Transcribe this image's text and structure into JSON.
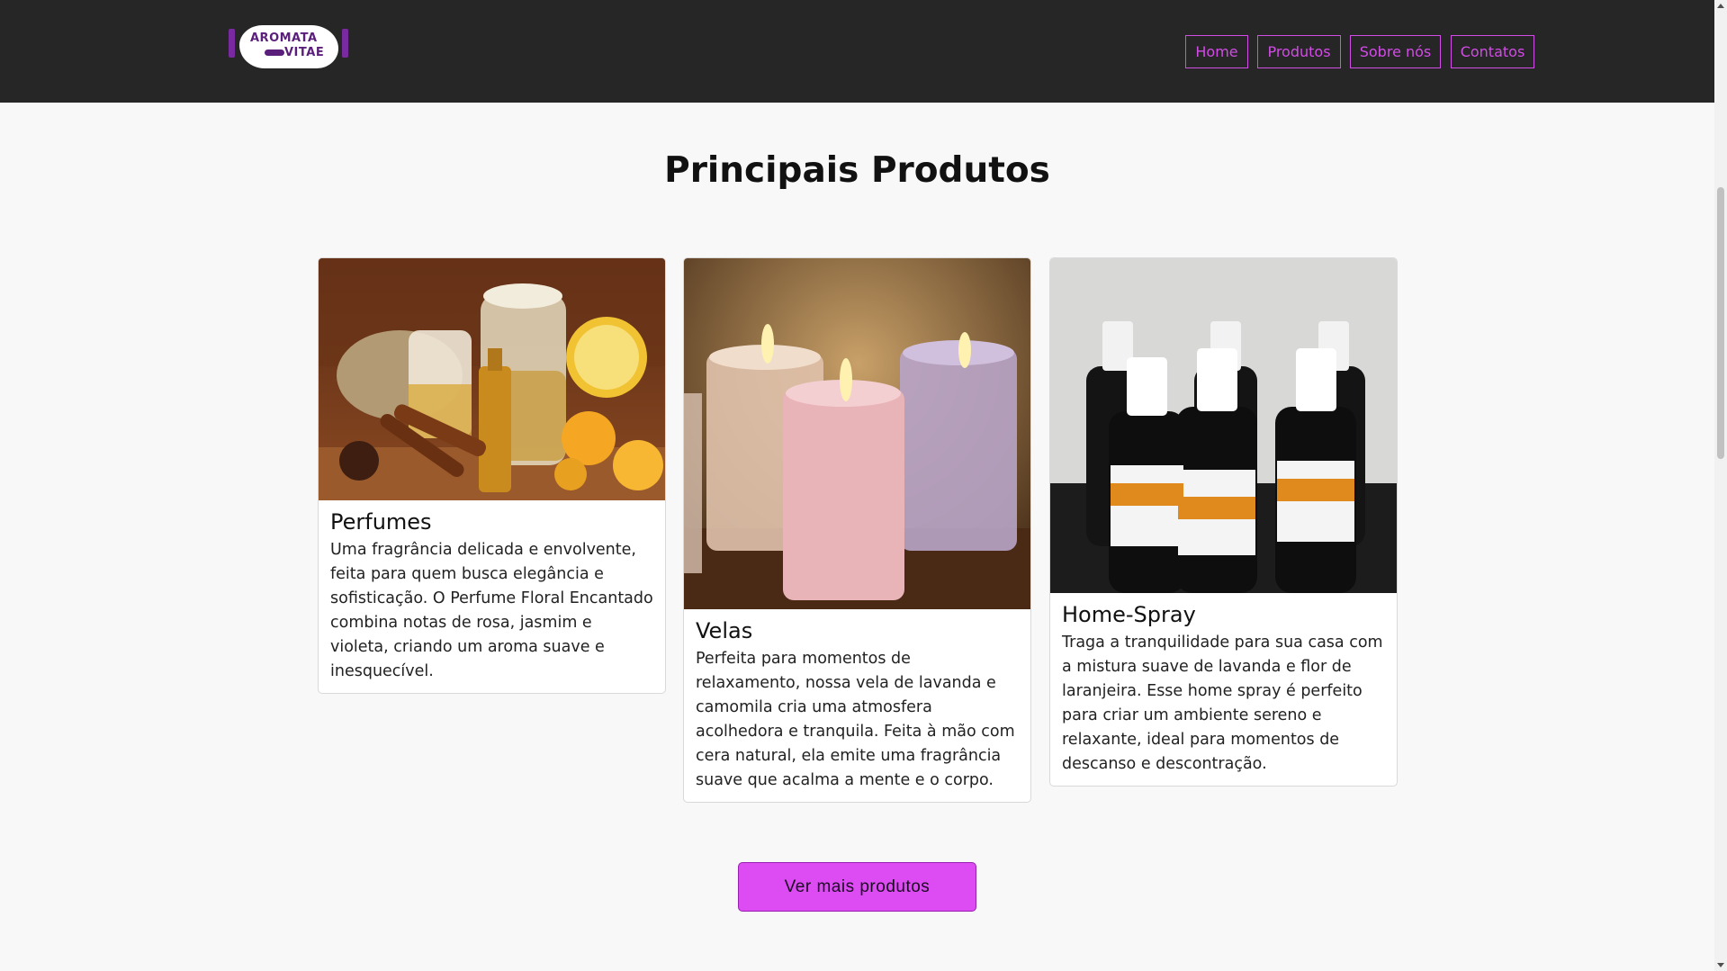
{
  "header": {
    "logo_line1": "AROMATA",
    "logo_line2": "VITAE",
    "nav": [
      {
        "label": "Home"
      },
      {
        "label": "Produtos"
      },
      {
        "label": "Sobre nós"
      },
      {
        "label": "Contatos"
      }
    ]
  },
  "main": {
    "title": "Principais Produtos",
    "cards": [
      {
        "title": "Perfumes",
        "text": "Uma fragrância delicada e envolvente, feita para quem busca elegância e sofisticação. O Perfume Floral Encantado combina notas de rosa, jasmim e violeta, criando um aroma suave e inesquecível."
      },
      {
        "title": "Velas",
        "text": "Perfeita para momentos de relaxamento, nossa vela de lavanda e camomila cria uma atmosfera acolhedora e tranquila. Feita à mão com cera natural, ela emite uma fragrância suave que acalma a mente e o corpo."
      },
      {
        "title": "Home-Spray",
        "text": "Traga a tranquilidade para sua casa com a mistura suave de lavanda e flor de laranjeira. Esse home spray é perfeito para criar um ambiente sereno e relaxante, ideal para momentos de descanso e descontração."
      }
    ],
    "cta_label": "Ver mais produtos"
  },
  "colors": {
    "header_bg": "#262626",
    "accent": "#dc4cf2",
    "nav_border": "#d24ce6",
    "page_bg": "#f8f8f8"
  }
}
